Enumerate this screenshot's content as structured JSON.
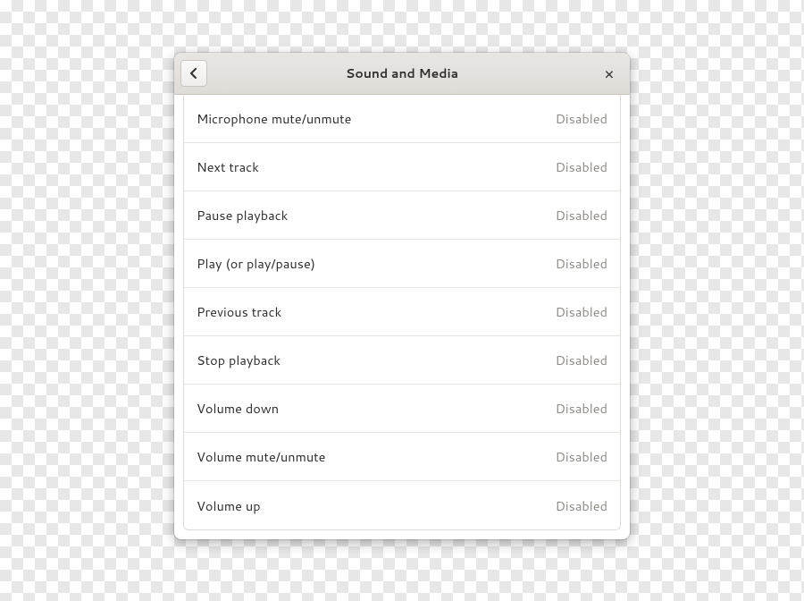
{
  "header": {
    "title": "Sound and Media"
  },
  "shortcuts": [
    {
      "label": "Microphone mute/unmute",
      "value": "Disabled"
    },
    {
      "label": "Next track",
      "value": "Disabled"
    },
    {
      "label": "Pause playback",
      "value": "Disabled"
    },
    {
      "label": "Play (or play/pause)",
      "value": "Disabled"
    },
    {
      "label": "Previous track",
      "value": "Disabled"
    },
    {
      "label": "Stop playback",
      "value": "Disabled"
    },
    {
      "label": "Volume down",
      "value": "Disabled"
    },
    {
      "label": "Volume mute/unmute",
      "value": "Disabled"
    },
    {
      "label": "Volume up",
      "value": "Disabled"
    }
  ]
}
